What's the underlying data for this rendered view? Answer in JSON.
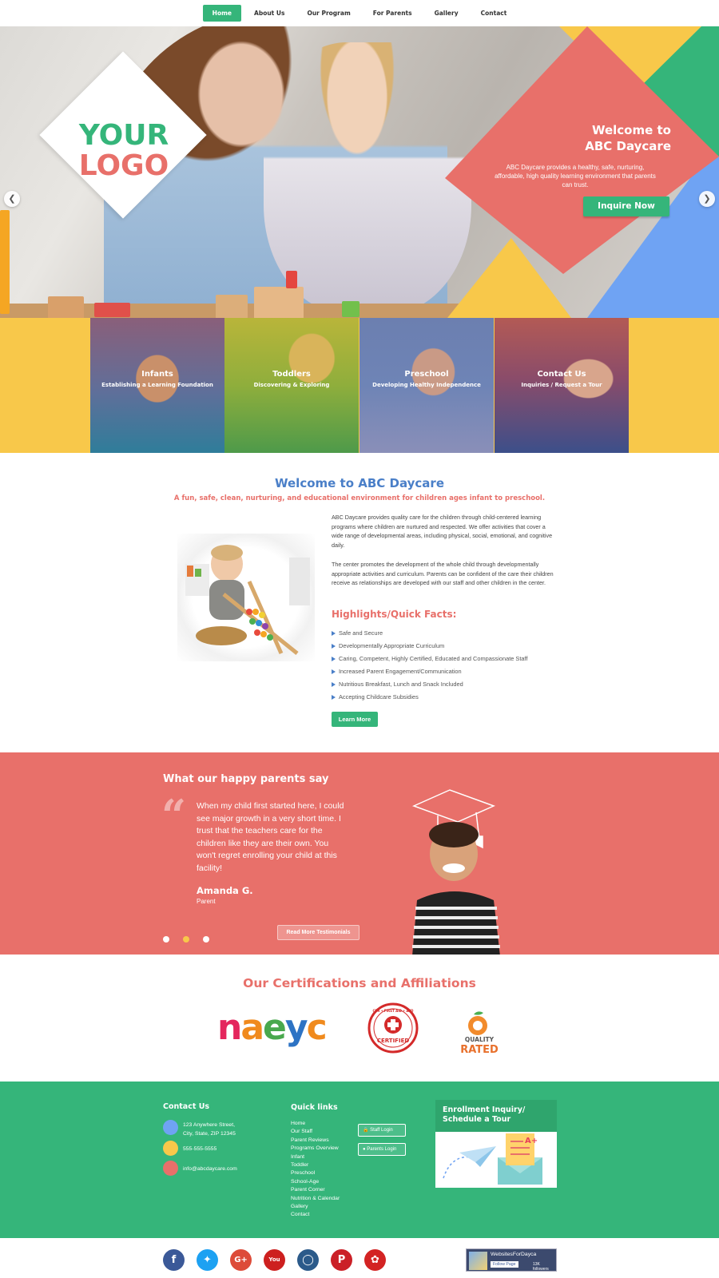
{
  "nav": {
    "items": [
      "Home",
      "About Us",
      "Our Program",
      "For Parents",
      "Gallery",
      "Contact"
    ],
    "active": "Home"
  },
  "hero": {
    "logo_line1": "YOUR",
    "logo_line2": "LOGO",
    "title_line1": "Welcome to",
    "title_line2": "ABC Daycare",
    "description": "ABC Daycare provides a healthy, safe, nurturing, affordable, high quality learning environment that parents can trust.",
    "cta_label": "Inquire Now",
    "prev_icon": "chevron-left-icon",
    "next_icon": "chevron-right-icon"
  },
  "programs": [
    {
      "title": "Infants",
      "subtitle": "Establishing a Learning Foundation"
    },
    {
      "title": "Toddlers",
      "subtitle": "Discovering & Exploring"
    },
    {
      "title": "Preschool",
      "subtitle": "Developing Healthy Independence"
    },
    {
      "title": "Contact Us",
      "subtitle": "Inquiries / Request a Tour"
    }
  ],
  "welcome": {
    "title": "Welcome to ABC Daycare",
    "subtitle": "A fun, safe, clean, nurturing, and educational environment for children ages infant to preschool.",
    "para1": "ABC Daycare provides quality care for the children through child-centered learning programs where children are nurtured and respected.  We offer activities that cover a wide range of developmental areas, including physical, social, emotional, and cognitive daily.",
    "para2": "The center promotes the development of the whole child through developmentally appropriate activities and curriculum.  Parents can be confident of the care their children receive as relationships are developed with our staff and other children in the center.",
    "highlights_title": "Highlights/Quick Facts:",
    "highlights": [
      "Safe and Secure",
      "Developmentally Appropriate Curriculum",
      "Caring, Competent, Highly Certified, Educated and Compassionate Staff",
      "Increased Parent Engagement/Communication",
      "Nutritious Breakfast, Lunch and Snack Included",
      "Accepting Childcare Subsidies"
    ],
    "learn_more_label": "Learn More"
  },
  "testimonial": {
    "section_title": "What our happy parents say",
    "quote": "When my child first started here, I could see major growth in a very short time. I trust that the teachers care for the children like they are their own. You won't regret enrolling your child at this facility!",
    "author": "Amanda G.",
    "role": "Parent",
    "more_label": "Read More Testimonials",
    "active_dot": 1
  },
  "certifications": {
    "title": "Our Certifications and Affiliations",
    "naeyc_letters": [
      "n",
      "a",
      "e",
      "y",
      "c"
    ],
    "cpr_top": "CPR • FIRST AID • AED",
    "cpr_bottom": "CERTIFIED",
    "quality_line1": "QUALITY",
    "quality_line2": "RATED"
  },
  "footer": {
    "contact_title": "Contact Us",
    "address": "123 Anywhere Street,\nCity, State, ZIP  12345",
    "phone": "555-555-5555",
    "email": "info@abcdaycare.com",
    "quick_links_title": "Quick links",
    "quick_links": [
      "Home",
      "Our Staff",
      "Parent Reviews",
      "Programs Overview",
      "Infant",
      "Toddler",
      "Preschool",
      "School-Age",
      "Parent Corner",
      "Nutrition & Calendar",
      "Gallery",
      "Contact"
    ],
    "staff_login": "Staff Login",
    "parents_login": "Parents Login",
    "enroll_title": "Enrollment Inquiry/ Schedule a Tour"
  },
  "social": {
    "icons": [
      "facebook-icon",
      "twitter-icon",
      "google-plus-icon",
      "youtube-icon",
      "instagram-icon",
      "pinterest-icon",
      "yelp-icon"
    ],
    "badge_title": "WebsitesForDayca",
    "badge_button": "Follow Page",
    "badge_count": "13K followers"
  },
  "colors": {
    "green": "#35b57a",
    "coral": "#e8706a",
    "yellow": "#f8c84a",
    "blue": "#6fa3f3",
    "heading_blue": "#4a7fc8"
  }
}
